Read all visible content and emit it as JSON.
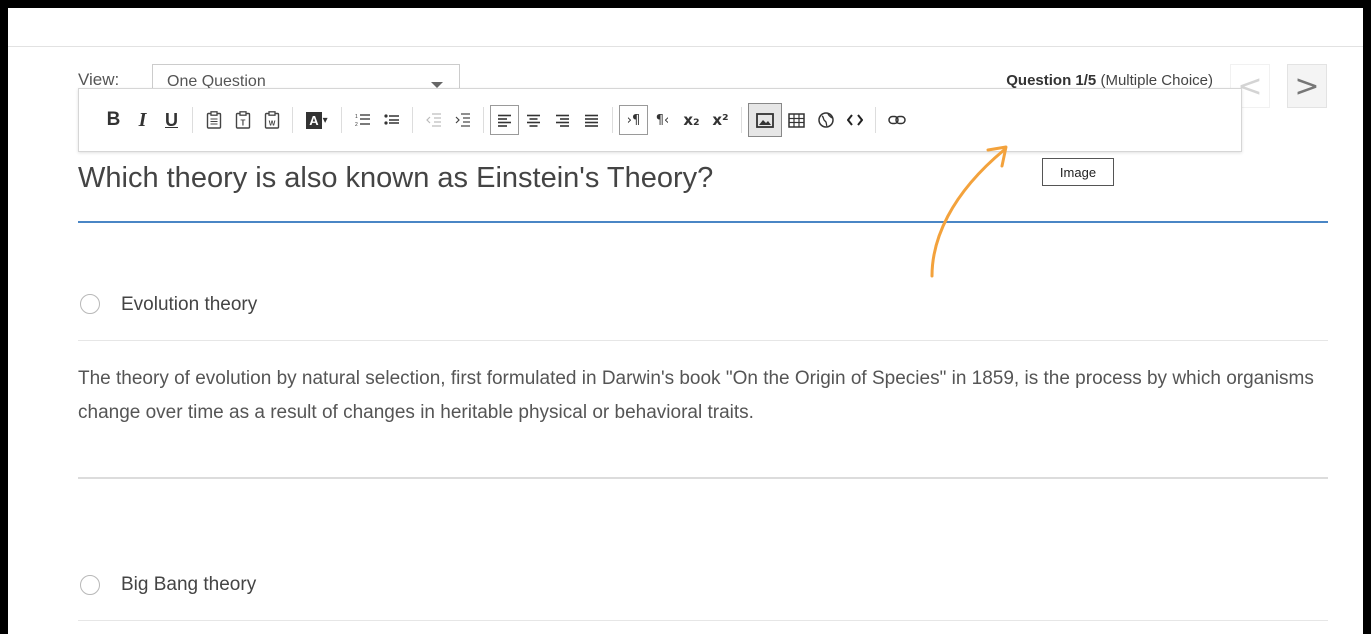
{
  "view": {
    "label": "View:",
    "selected": "One Question"
  },
  "question_info": {
    "number": "Question 1/5",
    "type": "(Multiple Choice)"
  },
  "nav": {
    "prev": "<",
    "next": ">"
  },
  "toolbar": {
    "bold": "B",
    "italic": "I",
    "underline": "U",
    "font_color": "A",
    "font_color_caret": "▾",
    "subscript": "x₂",
    "superscript": "x²",
    "ltr": "›¶",
    "rtl": "¶‹"
  },
  "tooltip": "Image",
  "question": "Which theory is also known as Einstein's Theory?",
  "answers": [
    {
      "label": "Evolution theory",
      "explanation": "The theory of evolution by natural selection, first formulated in Darwin's book \"On the Origin of Species\" in 1859, is the process by which organisms change over time as a result of changes in heritable physical or behavioral traits."
    },
    {
      "label": "Big Bang theory"
    }
  ],
  "colors": {
    "accent_underline": "#4a86c5",
    "annotation_arrow": "#f3a23c"
  }
}
